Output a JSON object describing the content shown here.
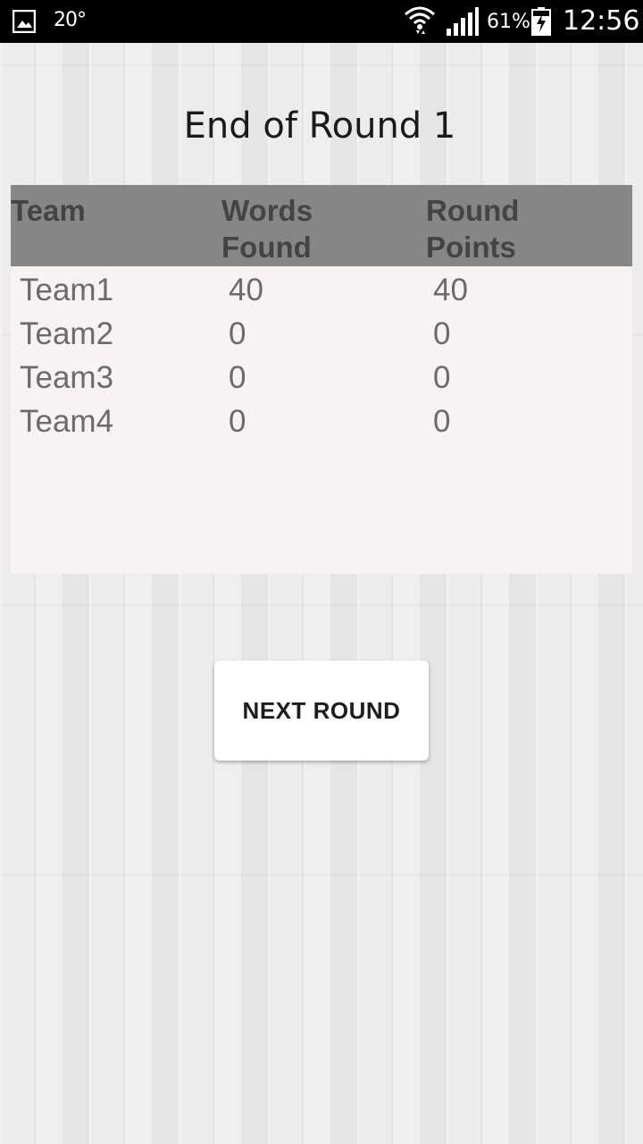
{
  "status_bar": {
    "temperature": "20°",
    "battery_percent": "61%",
    "time": "12:56",
    "icons": [
      "gallery-icon",
      "wifi-icon",
      "signal-icon",
      "battery-charging-icon"
    ]
  },
  "title": "End of Round 1",
  "table": {
    "headers": {
      "team": "Team",
      "words_found": "Words Found",
      "round_points": "Round Points"
    },
    "rows": [
      {
        "team": "Team1",
        "words_found": "40",
        "round_points": "40"
      },
      {
        "team": "Team2",
        "words_found": "0",
        "round_points": "0"
      },
      {
        "team": "Team3",
        "words_found": "0",
        "round_points": "0"
      },
      {
        "team": "Team4",
        "words_found": "0",
        "round_points": "0"
      }
    ]
  },
  "next_round_button": {
    "label": "NEXT ROUND"
  },
  "colors": {
    "header_bg": "#868686",
    "table_bg": "#f8f2f2",
    "button_bg": "#ffffff"
  }
}
